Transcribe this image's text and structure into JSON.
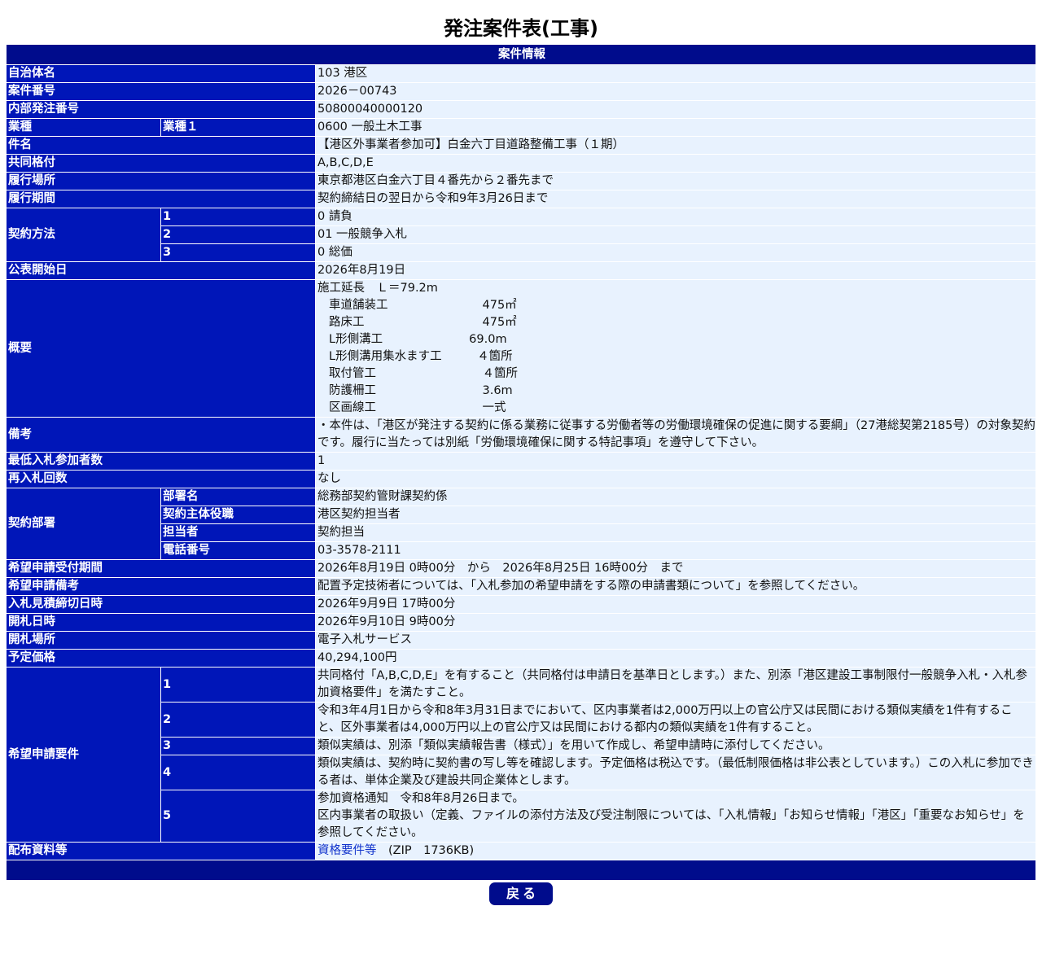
{
  "title": "発注案件表(工事)",
  "section_header": "案件情報",
  "rows": {
    "municipality": {
      "label": "自治体名",
      "value": "103 港区"
    },
    "case_number": {
      "label": "案件番号",
      "value": "2026－00743"
    },
    "internal_number": {
      "label": "内部発注番号",
      "value": "50800040000120"
    },
    "industry": {
      "label": "業種",
      "sub": "業種１",
      "value": "0600 一般土木工事"
    },
    "subject": {
      "label": "件名",
      "value": "【港区外事業者参加可】白金六丁目道路整備工事（１期）"
    },
    "joint_rating": {
      "label": "共同格付",
      "value": "A,B,C,D,E"
    },
    "location": {
      "label": "履行場所",
      "value": "東京都港区白金六丁目４番先から２番先まで"
    },
    "period": {
      "label": "履行期間",
      "value": "契約締結日の翌日から令和9年3月26日まで"
    },
    "contract_method": {
      "label": "契約方法",
      "items": [
        {
          "no": "1",
          "value": "0 請負"
        },
        {
          "no": "2",
          "value": "01 一般競争入札"
        },
        {
          "no": "3",
          "value": "0 総価"
        }
      ]
    },
    "publish_date": {
      "label": "公表開始日",
      "value": "2026年8月19日"
    },
    "summary": {
      "label": "概要",
      "head": "施工延長　Ｌ＝79.2m",
      "lines": [
        "車道舗装工　　　　　　　　475㎡",
        "路床工　　　　　　　　　　475㎡",
        "L形側溝工　　　　　　　 69.0m",
        "L形側溝用集水ます工　　　４箇所",
        "取付管工　　　　　　　　　４箇所",
        "防護柵工　　　　　　　　　3.6m",
        "区画線工　　　　　　　　　一式"
      ]
    },
    "remarks": {
      "label": "備考",
      "value": "・本件は、「港区が発注する契約に係る業務に従事する労働者等の労働環境確保の促進に関する要綱」（27港総契第2185号）の対象契約です。履行に当たっては別紙「労働環境確保に関する特記事項」を遵守して下さい。"
    },
    "min_bidders": {
      "label": "最低入札参加者数",
      "value": "1"
    },
    "rebid_count": {
      "label": "再入札回数",
      "value": "なし"
    },
    "contract_dept": {
      "label": "契約部署",
      "items": [
        {
          "sub": "部署名",
          "value": "総務部契約管財課契約係"
        },
        {
          "sub": "契約主体役職",
          "value": "港区契約担当者"
        },
        {
          "sub": "担当者",
          "value": "契約担当"
        },
        {
          "sub": "電話番号",
          "value": "03-3578-2111"
        }
      ]
    },
    "application_period": {
      "label": "希望申請受付期間",
      "value": "2026年8月19日 0時00分　から　2026年8月25日 16時00分　まで"
    },
    "application_remarks": {
      "label": "希望申請備考",
      "value": "配置予定技術者については、「入札参加の希望申請をする際の申請書類について」を参照してください。"
    },
    "bid_deadline": {
      "label": "入札見積締切日時",
      "value": "2026年9月9日 17時00分"
    },
    "opening_datetime": {
      "label": "開札日時",
      "value": "2026年9月10日 9時00分"
    },
    "opening_place": {
      "label": "開札場所",
      "value": "電子入札サービス"
    },
    "planned_price": {
      "label": "予定価格",
      "value": "40,294,100円"
    },
    "requirements": {
      "label": "希望申請要件",
      "items": [
        {
          "no": "1",
          "lines": [
            "共同格付「A,B,C,D,E」を有すること（共同格付は申請日を基準日とします。）また、別添「港区建設工事制限付一般競争入札・入札参加資格要件」を満たすこと。"
          ]
        },
        {
          "no": "2",
          "lines": [
            "令和3年4月1日から令和8年3月31日までにおいて、区内事業者は2,000万円以上の官公庁又は民間における類似実績を1件有すること、区外事業者は4,000万円以上の官公庁又は民間における都内の類似実績を1件有すること。"
          ]
        },
        {
          "no": "3",
          "lines": [
            "類似実績は、別添「類似実績報告書（様式）」を用いて作成し、希望申請時に添付してください。"
          ]
        },
        {
          "no": "4",
          "lines": [
            "類似実績は、契約時に契約書の写し等を確認します。予定価格は税込です。（最低制限価格は非公表としています。）この入札に参加できる者は、単体企業及び建設共同企業体とします。"
          ]
        },
        {
          "no": "5",
          "lines": [
            "参加資格通知　令和8年8月26日まで。",
            "区内事業者の取扱い（定義、ファイルの添付方法及び受注制限については、「入札情報」「お知らせ情報」「港区」「重要なお知らせ」を参照してください。"
          ]
        }
      ]
    },
    "distribution": {
      "label": "配布資料等",
      "link": "資格要件等",
      "size": "　(ZIP　1736KB)"
    }
  },
  "back_button": "戻る"
}
